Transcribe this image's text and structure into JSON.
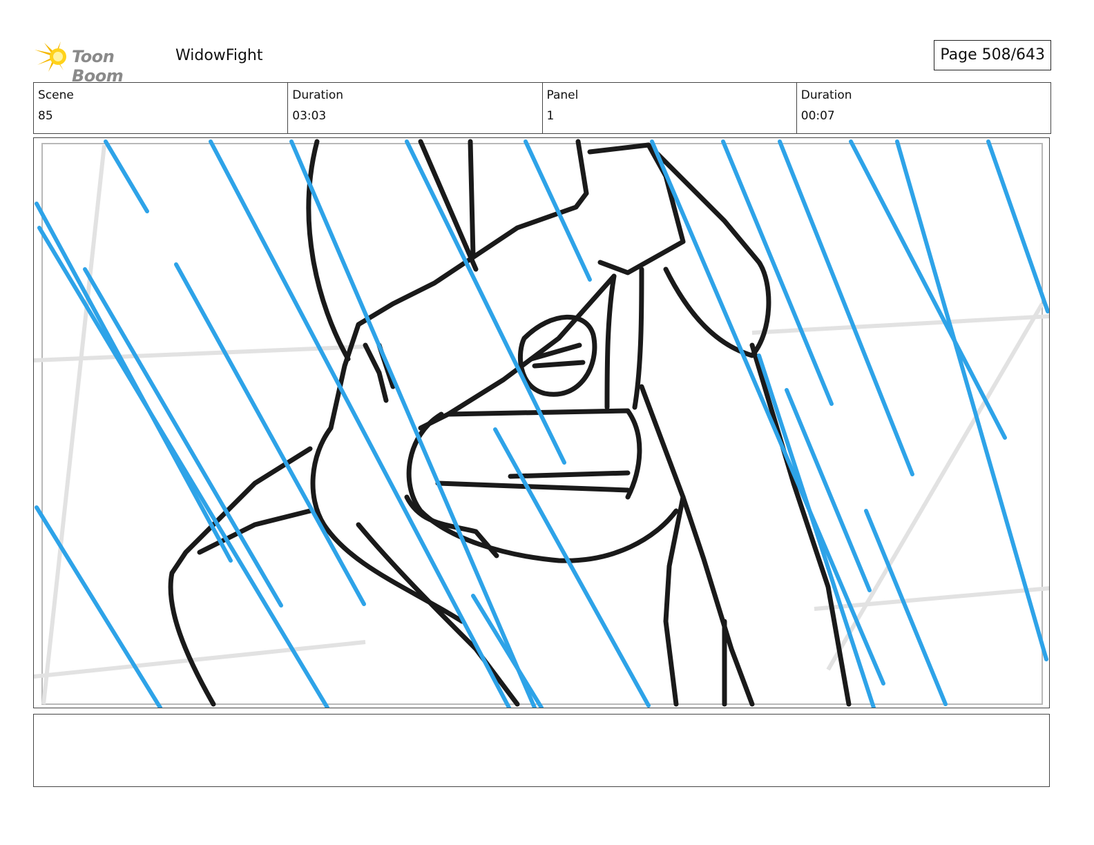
{
  "header": {
    "brand": "Toon Boom",
    "project_title": "WidowFight",
    "page_indicator": "Page 508/643"
  },
  "info": {
    "scene_label": "Scene",
    "scene_value": "85",
    "scene_duration_label": "Duration",
    "scene_duration_value": "03:03",
    "panel_label": "Panel",
    "panel_value": "1",
    "panel_duration_label": "Duration",
    "panel_duration_value": "00:07"
  },
  "panel": {
    "drawing": "storyboard-sketch",
    "rain_color": "#2ea3e8",
    "ink_color": "#1a1a1a",
    "guide_color": "#e2e2e2"
  },
  "notes": {
    "text": ""
  }
}
